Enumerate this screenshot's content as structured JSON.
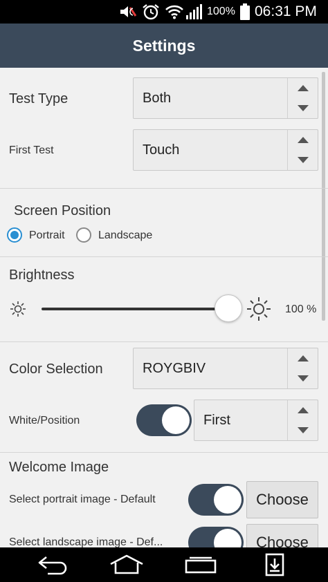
{
  "statusbar": {
    "battery_percent": "100%",
    "time": "06:31 PM",
    "icons": [
      "mute-icon",
      "alarm-icon",
      "wifi-icon",
      "signal-icon",
      "battery-icon"
    ]
  },
  "header": {
    "title": "Settings"
  },
  "test_type": {
    "label": "Test Type",
    "value": "Both"
  },
  "first_test": {
    "label": "First Test",
    "value": "Touch"
  },
  "screen_position": {
    "label": "Screen Position",
    "options": [
      "Portrait",
      "Landscape"
    ],
    "selected": "Portrait"
  },
  "brightness": {
    "label": "Brightness",
    "value_text": "100 %",
    "value": 100
  },
  "color_selection": {
    "label": "Color Selection",
    "value": "ROYGBIV"
  },
  "white_position": {
    "label": "White/Position",
    "toggle_on": true,
    "value": "First"
  },
  "welcome_image": {
    "label": "Welcome Image",
    "portrait": {
      "label": "Select portrait image - Default",
      "toggle_on": true,
      "button": "Choose"
    },
    "landscape": {
      "label": "Select landscape image - Def...",
      "toggle_on": true,
      "button": "Choose"
    }
  },
  "colors": {
    "accent": "#2a8fd2",
    "header": "#3b4a5b"
  }
}
